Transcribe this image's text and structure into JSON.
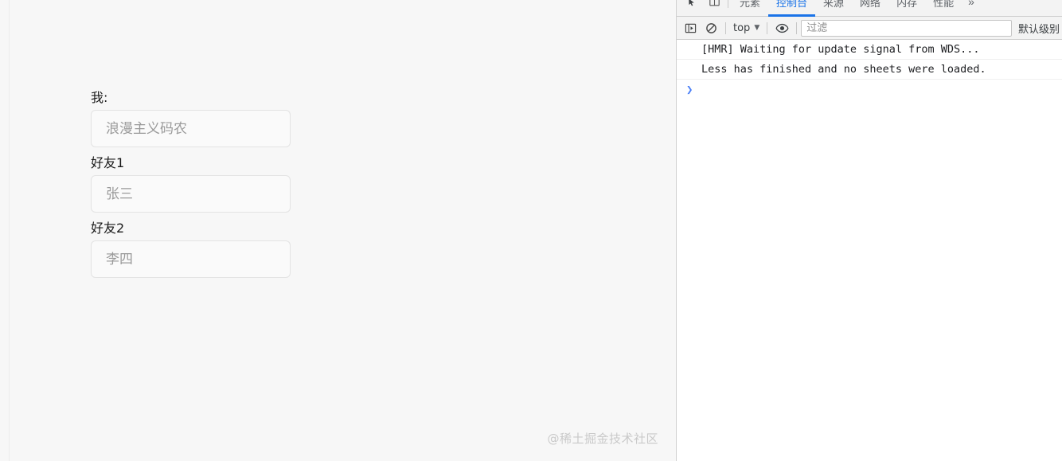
{
  "page": {
    "form": {
      "fields": [
        {
          "label": "我:",
          "placeholder": "浪漫主义码农",
          "value": ""
        },
        {
          "label": "好友1",
          "placeholder": "张三",
          "value": ""
        },
        {
          "label": "好友2",
          "placeholder": "李四",
          "value": ""
        }
      ]
    },
    "watermark": "@稀土掘金技术社区"
  },
  "devtools": {
    "tabs": [
      {
        "label": "元素",
        "active": false
      },
      {
        "label": "控制台",
        "active": true
      },
      {
        "label": "来源",
        "active": false
      },
      {
        "label": "网络",
        "active": false
      },
      {
        "label": "内存",
        "active": false
      },
      {
        "label": "性能",
        "active": false
      }
    ],
    "overflow_label": "»",
    "icons": {
      "inspect": "inspect-element-icon",
      "device": "device-toolbar-icon",
      "sidebar": "console-sidebar-icon",
      "clear": "clear-console-icon",
      "eye": "live-expression-icon"
    },
    "filter_bar": {
      "context": "top",
      "filter_placeholder": "过滤",
      "filter_value": "",
      "level": "默认级别"
    },
    "console": {
      "messages": [
        "[HMR] Waiting for update signal from WDS...",
        "Less has finished and no sheets were loaded."
      ],
      "prompt": "❯"
    },
    "accent_color": "#1a73e8"
  }
}
